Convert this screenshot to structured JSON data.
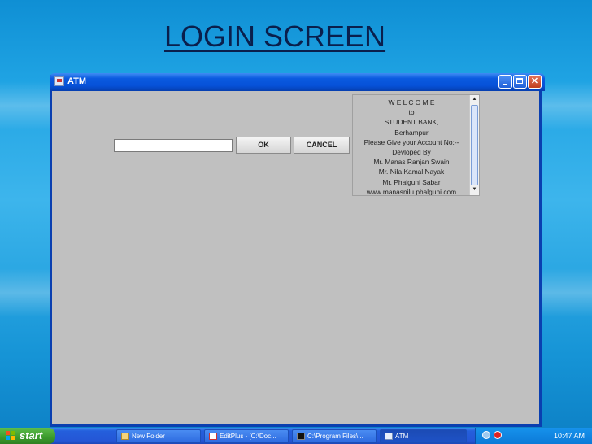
{
  "slide": {
    "title": "LOGIN SCREEN"
  },
  "window": {
    "title": "ATM",
    "input": {
      "value": "",
      "placeholder": ""
    },
    "ok_label": "OK",
    "cancel_label": "CANCEL",
    "message_lines": [
      "W E L C O M E",
      "to",
      "STUDENT BANK,",
      "Berhampur",
      "Please Give your Account No:--",
      "Devloped By",
      "Mr. Manas Ranjan Swain",
      "Mr. Nila Kamal Nayak",
      "Mr. Phalguni Sabar",
      "www.manasnilu.phalguni.com"
    ]
  },
  "taskbar": {
    "start_label": "start",
    "items": [
      {
        "label": "New Folder",
        "icon": "folder-icon"
      },
      {
        "label": "EditPlus - [C:\\Doc...",
        "icon": "editplus-icon"
      },
      {
        "label": "C:\\Program Files\\...",
        "icon": "console-icon"
      },
      {
        "label": "ATM",
        "icon": "java-app-icon"
      }
    ],
    "clock": "10:47 AM"
  },
  "colors": {
    "title_bar": "#0651d8",
    "window_body": "#c0c0c0",
    "taskbar": "#2456d6",
    "start_button": "#3b9a2c"
  }
}
